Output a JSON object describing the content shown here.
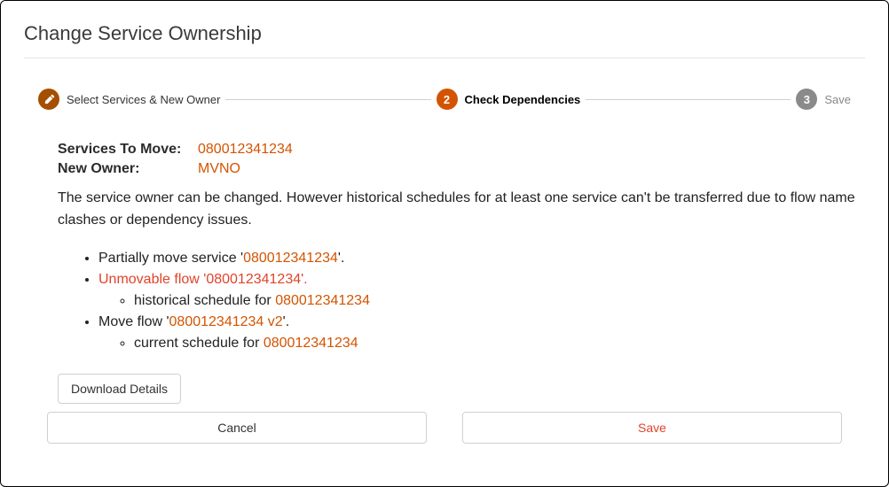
{
  "title": "Change Service Ownership",
  "stepper": {
    "step1": {
      "label": "Select Services & New Owner"
    },
    "step2": {
      "number": "2",
      "label": "Check Dependencies"
    },
    "step3": {
      "number": "3",
      "label": "Save"
    }
  },
  "summary": {
    "services_to_move_label": "Services To Move:",
    "services_to_move_value": "080012341234",
    "new_owner_label": "New Owner:",
    "new_owner_value": "MVNO"
  },
  "message": "The service owner can be changed. However historical schedules for at least one service can't be transferred due to flow name clashes or dependency issues.",
  "deps": {
    "item1_prefix": "Partially move service '",
    "item1_link": "080012341234",
    "item1_suffix": "'.",
    "item2_prefix": "Unmovable flow '",
    "item2_link": "080012341234",
    "item2_suffix": "'.",
    "item2a_prefix": "historical schedule for ",
    "item2a_link": "080012341234",
    "item3_prefix": "Move flow '",
    "item3_link": "080012341234 v2",
    "item3_suffix": "'.",
    "item3a_prefix": "current schedule for ",
    "item3a_link": "080012341234"
  },
  "buttons": {
    "download": "Download Details",
    "cancel": "Cancel",
    "save": "Save"
  }
}
